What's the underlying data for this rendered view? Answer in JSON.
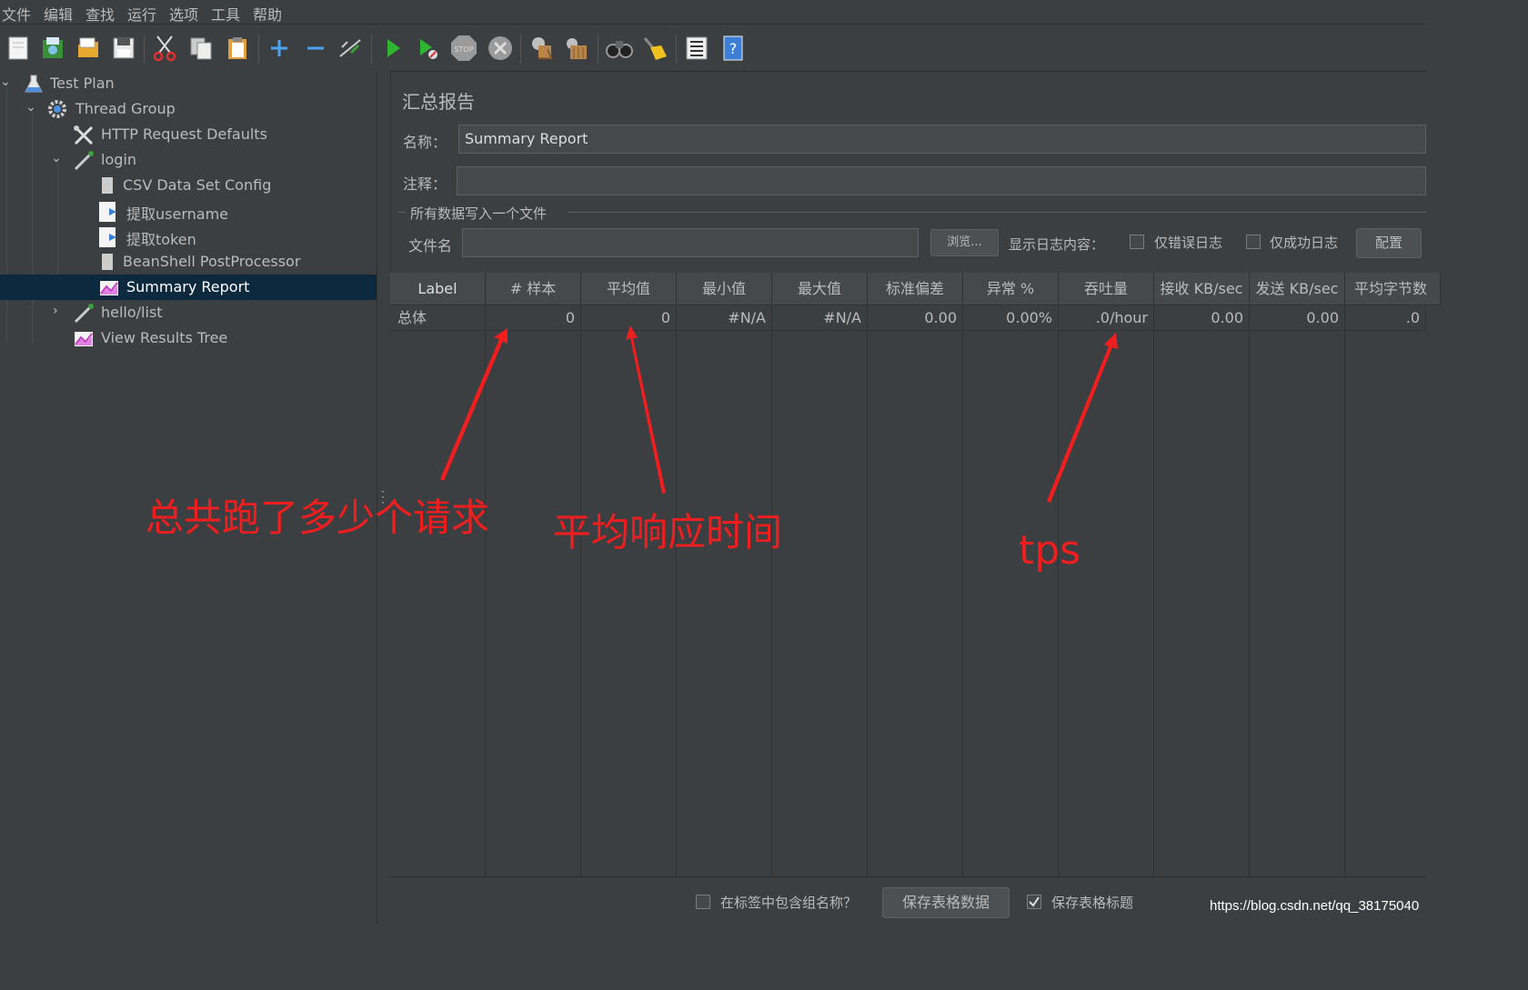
{
  "menu": [
    "文件",
    "编辑",
    "查找",
    "运行",
    "选项",
    "工具",
    "帮助"
  ],
  "toolbar": {
    "icons": [
      "new-icon",
      "templates-icon",
      "open-icon",
      "save-icon",
      "cut-icon",
      "copy-icon",
      "paste-icon",
      "expand-icon",
      "collapse-icon",
      "toggle-icon",
      "start-icon",
      "start-no-pause-icon",
      "stop-icon",
      "shutdown-icon",
      "clear-icon",
      "clear-all-icon",
      "search-icon",
      "reset-search-icon",
      "function-helper-icon",
      "help-icon"
    ]
  },
  "tree": {
    "items": [
      {
        "label": "Test Plan"
      },
      {
        "label": "Thread Group"
      },
      {
        "label": "HTTP Request Defaults"
      },
      {
        "label": "login"
      },
      {
        "label": "CSV Data Set Config"
      },
      {
        "label": "提取username"
      },
      {
        "label": "提取token"
      },
      {
        "label": "BeanShell PostProcessor"
      },
      {
        "label": "Summary Report"
      },
      {
        "label": "hello/list"
      },
      {
        "label": "View Results Tree"
      }
    ],
    "selected": "Summary Report"
  },
  "panel": {
    "title": "汇总报告",
    "name_label": "名称：",
    "name_value": "Summary Report",
    "comment_label": "注释：",
    "comment_value": "",
    "file_group_label": "所有数据写入一个文件",
    "filename_label": "文件名",
    "filename_value": "",
    "browse_button": "浏览...",
    "log_display_label": "显示日志内容：",
    "errors_only_label": "仅错误日志",
    "success_only_label": "仅成功日志",
    "configure_button": "配置"
  },
  "table": {
    "headers": [
      "Label",
      "# 样本",
      "平均值",
      "最小值",
      "最大值",
      "标准偏差",
      "异常 %",
      "吞吐量",
      "接收 KB/sec",
      "发送 KB/sec",
      "平均字节数"
    ],
    "rows": [
      [
        "总体",
        "0",
        "0",
        "#N/A",
        "#N/A",
        "0.00",
        "0.00%",
        ".0/hour",
        "0.00",
        "0.00",
        ".0"
      ]
    ]
  },
  "bottom": {
    "include_group_label": "在标签中包含组名称？",
    "include_group_checked": false,
    "save_table_button": "保存表格数据",
    "save_header_label": "保存表格标题",
    "save_header_checked": true
  },
  "annotations": {
    "total_requests": "总共跑了多少个请求",
    "avg_response": "平均响应时间",
    "tps": "tps"
  },
  "watermark": "https://blog.csdn.net/qq_38175040",
  "colors": {
    "background": "#3c3f41",
    "selection": "#0d293e",
    "annotation": "#f01e1e",
    "text": "#bbbbbb"
  }
}
